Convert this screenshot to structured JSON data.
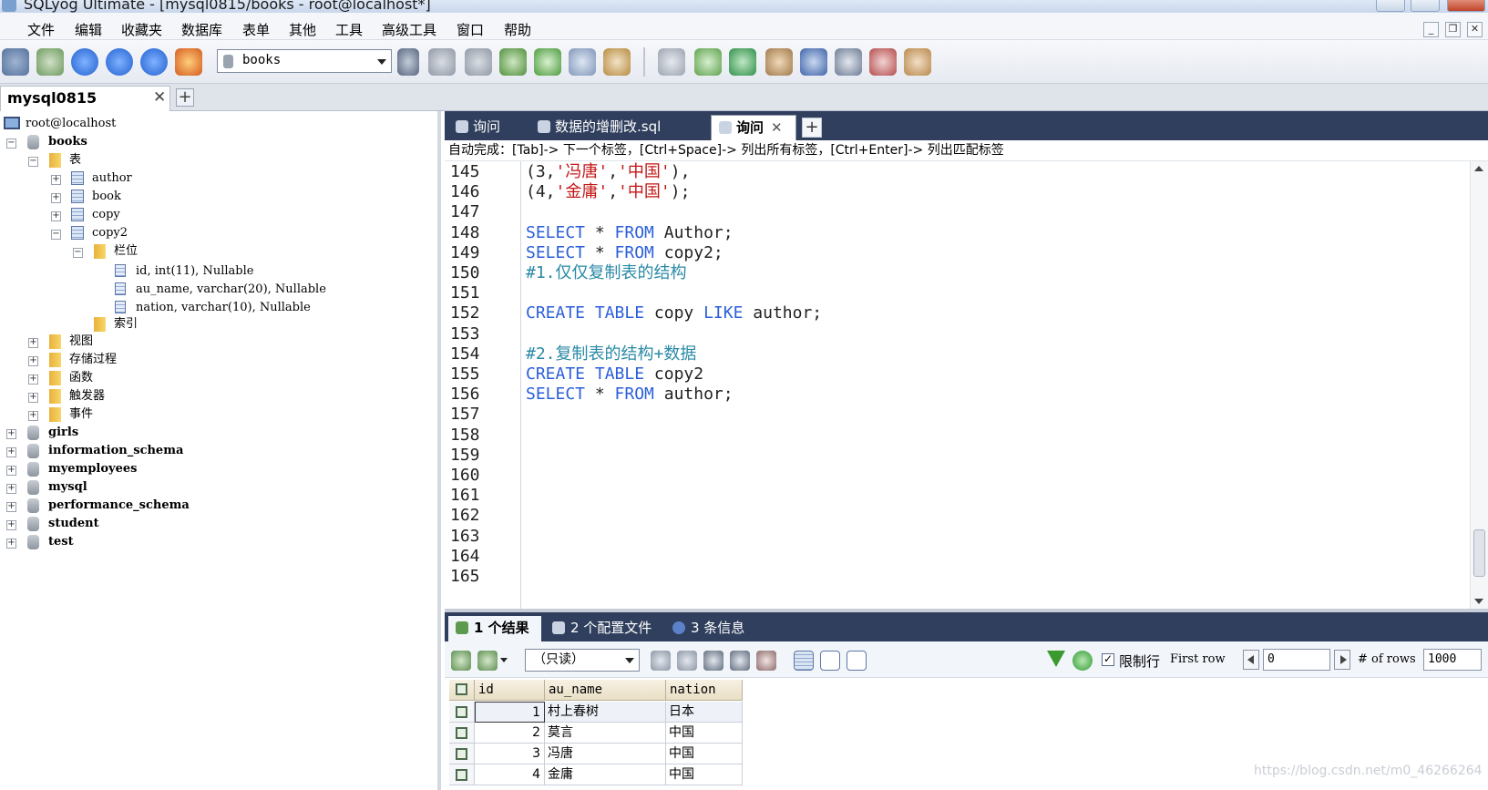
{
  "window": {
    "title": "SQLyog Ultimate - [mysql0815/books - root@localhost*]"
  },
  "menu": [
    "文件",
    "编辑",
    "收藏夹",
    "数据库",
    "表单",
    "其他",
    "工具",
    "高级工具",
    "窗口",
    "帮助"
  ],
  "toolbar": {
    "database_select": "books"
  },
  "connection_tab": {
    "label": "mysql0815",
    "close": "✕",
    "add": "+"
  },
  "tree": {
    "host": "root@localhost",
    "db_books": "books",
    "tables_folder": "表",
    "tables": [
      "author",
      "book",
      "copy",
      "copy2"
    ],
    "columns_folder": "栏位",
    "columns": [
      "id, int(11), Nullable",
      "au_name, varchar(20), Nullable",
      "nation, varchar(10), Nullable"
    ],
    "index_folder": "索引",
    "folders": [
      "视图",
      "存储过程",
      "函数",
      "触发器",
      "事件"
    ],
    "other_dbs": [
      "girls",
      "information_schema",
      "myemployees",
      "mysql",
      "performance_schema",
      "student",
      "test"
    ]
  },
  "editor_tabs": [
    {
      "label": "询问"
    },
    {
      "label": "数据的增删改.sql"
    },
    {
      "label": "询问",
      "active": true
    }
  ],
  "editor_tab_add": "+",
  "autocomplete_hint": "自动完成：[Tab]-> 下一个标签，[Ctrl+Space]-> 列出所有标签，[Ctrl+Enter]-> 列出匹配标签",
  "editor": {
    "line_numbers": [
      "145",
      "146",
      "147",
      "148",
      "149",
      "150",
      "151",
      "152",
      "153",
      "154",
      "155",
      "156",
      "157",
      "158",
      "159",
      "160",
      "161",
      "162",
      "163",
      "164",
      "165"
    ],
    "lines": [
      {
        "num": "145",
        "tokens": [
          {
            "t": "(3,",
            "c": "pun"
          },
          {
            "t": "'冯唐'",
            "c": "str"
          },
          {
            "t": ",",
            "c": "pun"
          },
          {
            "t": "'中国'",
            "c": "str"
          },
          {
            "t": "),",
            "c": "pun"
          }
        ]
      },
      {
        "num": "146",
        "tokens": [
          {
            "t": "(4,",
            "c": "pun"
          },
          {
            "t": "'金庸'",
            "c": "str"
          },
          {
            "t": ",",
            "c": "pun"
          },
          {
            "t": "'中国'",
            "c": "str"
          },
          {
            "t": ");",
            "c": "pun"
          }
        ]
      },
      {
        "num": "147",
        "tokens": []
      },
      {
        "num": "148",
        "tokens": [
          {
            "t": "SELECT",
            "c": "kw"
          },
          {
            "t": " * ",
            "c": "pun"
          },
          {
            "t": "FROM",
            "c": "kw"
          },
          {
            "t": " Author;",
            "c": "pun"
          }
        ]
      },
      {
        "num": "149",
        "tokens": [
          {
            "t": "SELECT",
            "c": "kw"
          },
          {
            "t": " * ",
            "c": "pun"
          },
          {
            "t": "FROM",
            "c": "kw"
          },
          {
            "t": " copy2;",
            "c": "pun"
          }
        ]
      },
      {
        "num": "150",
        "tokens": [
          {
            "t": "#1.仅仅复制表的结构",
            "c": "cm"
          }
        ]
      },
      {
        "num": "151",
        "tokens": []
      },
      {
        "num": "152",
        "tokens": [
          {
            "t": "CREATE",
            "c": "kw"
          },
          {
            "t": " ",
            "c": "pun"
          },
          {
            "t": "TABLE",
            "c": "kw"
          },
          {
            "t": " copy ",
            "c": "pun"
          },
          {
            "t": "LIKE",
            "c": "kw"
          },
          {
            "t": " author;",
            "c": "pun"
          }
        ]
      },
      {
        "num": "153",
        "tokens": []
      },
      {
        "num": "154",
        "tokens": [
          {
            "t": "#2.复制表的结构+数据",
            "c": "cm"
          }
        ]
      },
      {
        "num": "155",
        "tokens": [
          {
            "t": "CREATE",
            "c": "kw"
          },
          {
            "t": " ",
            "c": "pun"
          },
          {
            "t": "TABLE",
            "c": "kw"
          },
          {
            "t": " copy2",
            "c": "pun"
          }
        ]
      },
      {
        "num": "156",
        "tokens": [
          {
            "t": "SELECT",
            "c": "kw"
          },
          {
            "t": " * ",
            "c": "pun"
          },
          {
            "t": "FROM",
            "c": "kw"
          },
          {
            "t": " author;",
            "c": "pun"
          }
        ]
      }
    ]
  },
  "result_tabs": [
    {
      "label": "1 个结果",
      "active": true
    },
    {
      "label": "2 个配置文件"
    },
    {
      "label": "3 条信息"
    }
  ],
  "result_toolbar": {
    "mode": "（只读）",
    "limit_label": "限制行",
    "limit_checked": true,
    "first_row_label": "First row",
    "first_row_value": "0",
    "rows_label": "# of rows",
    "rows_value": "1000"
  },
  "grid": {
    "columns": [
      "id",
      "au_name",
      "nation"
    ],
    "rows": [
      [
        "1",
        "村上春树",
        "日本"
      ],
      [
        "2",
        "莫言",
        "中国"
      ],
      [
        "3",
        "冯唐",
        "中国"
      ],
      [
        "4",
        "金庸",
        "中国"
      ]
    ]
  },
  "watermark": "https://blog.csdn.net/m0_46266264",
  "colors": {
    "keyword": "#2b5fd9",
    "comment": "#2a8aa6",
    "string": "#c41616",
    "tab_bar": "#2f3f5d"
  }
}
